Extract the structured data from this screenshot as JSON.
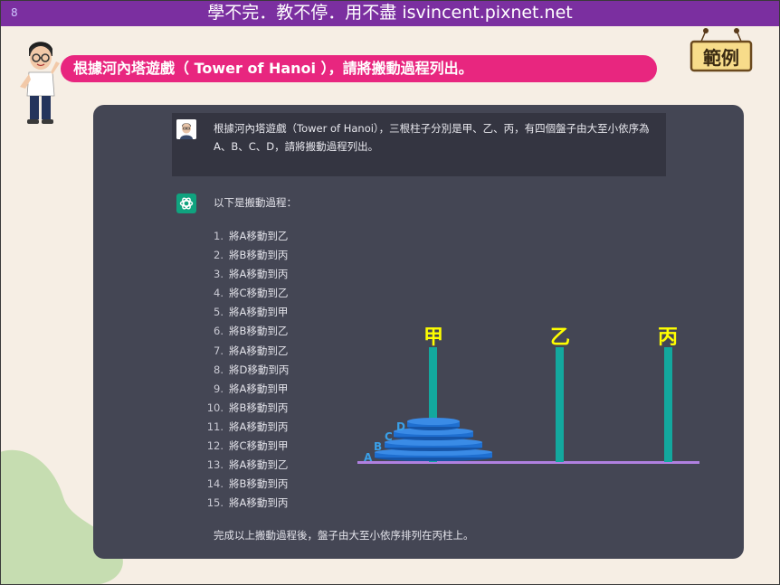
{
  "banner": {
    "page_number": "8",
    "text": "學不完．教不停．用不盡 isvincent.pixnet.net"
  },
  "title": "根據河內塔遊戲（ Tower of Hanoi ），請將搬動過程列出。",
  "badge": "範例",
  "chat": {
    "user_message": "根據河內塔遊戲（Tower of Hanoi），三根柱子分別是甲、乙、丙，有四個盤子由大至小依序為A、B、C、D，請將搬動過程列出。",
    "assistant_intro": "以下是搬動過程：",
    "steps": [
      {
        "num": "1.",
        "text": "將A移動到乙"
      },
      {
        "num": "2.",
        "text": "將B移動到丙"
      },
      {
        "num": "3.",
        "text": "將A移動到丙"
      },
      {
        "num": "4.",
        "text": "將C移動到乙"
      },
      {
        "num": "5.",
        "text": "將A移動到甲"
      },
      {
        "num": "6.",
        "text": "將B移動到乙"
      },
      {
        "num": "7.",
        "text": "將A移動到乙"
      },
      {
        "num": "8.",
        "text": "將D移動到丙"
      },
      {
        "num": "9.",
        "text": "將A移動到甲"
      },
      {
        "num": "10.",
        "text": "將B移動到丙"
      },
      {
        "num": "11.",
        "text": "將A移動到丙"
      },
      {
        "num": "12.",
        "text": "將C移動到甲"
      },
      {
        "num": "13.",
        "text": "將A移動到乙"
      },
      {
        "num": "14.",
        "text": "將B移動到丙"
      },
      {
        "num": "15.",
        "text": "將A移動到丙"
      }
    ],
    "assistant_summary": "完成以上搬動過程後，盤子由大至小依序排列在丙柱上。"
  },
  "hanoi": {
    "pegs": [
      "甲",
      "乙",
      "丙"
    ],
    "disks": [
      "A",
      "B",
      "C",
      "D"
    ]
  },
  "colors": {
    "banner": "#7b2fa0",
    "title_pill": "#e8267f",
    "chat_bg": "#444654",
    "user_bg": "#343541",
    "bot_avatar": "#10a37f",
    "peg": "#13a89e",
    "disk": "#1f6fd0",
    "peg_label": "#ffff00",
    "base": "#b080e0"
  }
}
